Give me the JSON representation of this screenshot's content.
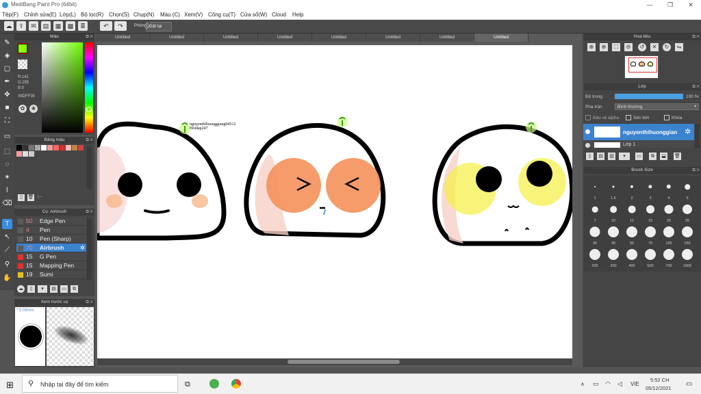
{
  "window": {
    "title": "MediBang Paint Pro (64bit)"
  },
  "menu": [
    "Tệp(F)",
    "Chỉnh sửa(E)",
    "Lớp(L)",
    "Bộ lọc(R)",
    "Chọn(S)",
    "Chụp(N)",
    "Màu (C)",
    "Xem(V)",
    "Công cụ(T)",
    "Cửa sổ(W)",
    "Cloud",
    "Help"
  ],
  "toolbar": {
    "key_label": "Phím",
    "reset_label": "Đặt lại"
  },
  "color_panel": {
    "title": "Màu",
    "r": "R:141",
    "g": "G:255",
    "b": "B:0",
    "hex": "#8DFF00",
    "main_color": "#8DFF00"
  },
  "swatch_panel": {
    "title": "Bảng màu",
    "swatches": [
      "#000000",
      "#333333",
      "#777777",
      "#aaaaaa",
      "#ffffff",
      "#ff9999",
      "#ff6666",
      "#cc3333",
      "#ffbbbb",
      "#bb8844",
      "#cc4444",
      "#ff9999",
      "#dddddd",
      "#cccccc"
    ]
  },
  "brush_panel": {
    "title": "Cọ: Airbrush",
    "items": [
      {
        "num": "50",
        "name": "Edge Pen",
        "color": "#555555"
      },
      {
        "num": "4",
        "name": "Pen",
        "color": "#555555"
      },
      {
        "num": "10",
        "name": "Pen (Sharp)",
        "color": "#555555"
      },
      {
        "num": "70",
        "name": "Airbrush",
        "color": "#555555"
      },
      {
        "num": "15",
        "name": "G Pen",
        "color": "#e03030"
      },
      {
        "num": "15",
        "name": "Mapping Pen",
        "color": "#e03030"
      },
      {
        "num": "19",
        "name": "Sumi",
        "color": "#e0c020"
      }
    ]
  },
  "preview_panel": {
    "title": "Xem trước cọ",
    "size": "5.08mm"
  },
  "tabs": [
    "Untitled",
    "Untitled",
    "Untitled",
    "Untitled",
    "Untitled",
    "Untitled",
    "Untitled",
    "Untitled"
  ],
  "canvas": {
    "signature_line1": "nguyenthihuonggiang94512",
    "signature_line2": "Hoidap247"
  },
  "navigator": {
    "title": "Hoa tiêu"
  },
  "layer_panel": {
    "title": "Lớp",
    "opacity_label": "Độ trong",
    "opacity_value": "100 %",
    "opacity_fraction": 1.0,
    "blend_label": "Pha trộn",
    "blend_value": "Bình thường",
    "protect_alpha": "Bảo vệ alpha",
    "clip": "Xén bớt",
    "lock": "Khóa",
    "layer_name": "nguyenthihuonggian",
    "layer_name2": "Lớp 1"
  },
  "brush_size": {
    "title": "Brush Size",
    "sizes": [
      "1",
      "1.5",
      "2",
      "3",
      "4",
      "5",
      "7",
      "10",
      "12",
      "15",
      "20",
      "25",
      "30",
      "40",
      "50",
      "70",
      "100",
      "150",
      "200",
      "300",
      "400",
      "500",
      "700",
      "1000"
    ]
  },
  "taskbar": {
    "search_placeholder": "Nhập tại đây để tìm kiếm",
    "lang": "VIE",
    "time": "5:52 CH",
    "date": "05/12/2021"
  }
}
